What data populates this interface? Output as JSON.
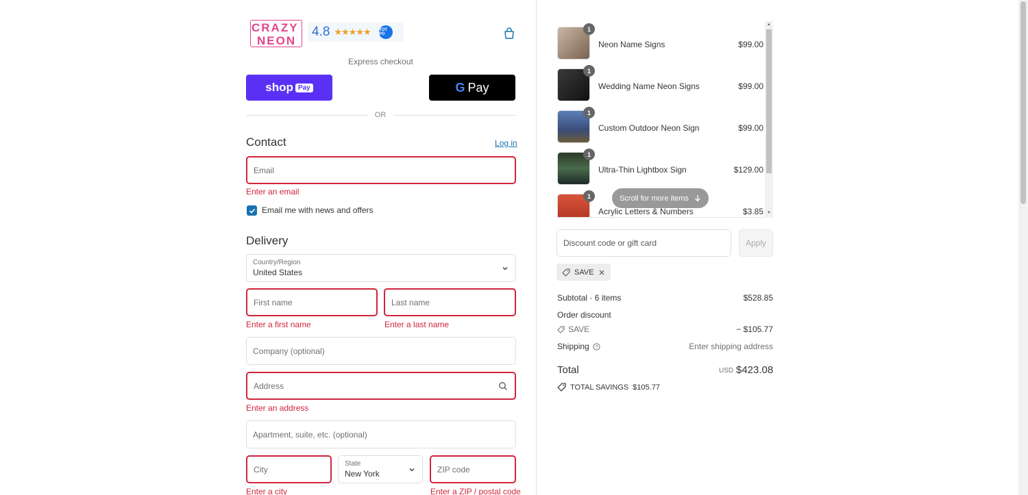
{
  "brand": {
    "logo_line1": "CRAZY",
    "logo_line2": "NEON",
    "rating_value": "4.8",
    "rating_stars": "★★★★★",
    "badge_text": "YOT PO"
  },
  "express": {
    "label": "Express checkout",
    "shop_pay_brand": "shop",
    "shop_pay_pay": "Pay",
    "gpay_g": "G",
    "gpay_pay": "Pay",
    "or": "OR"
  },
  "contact": {
    "title": "Contact",
    "login": "Log in",
    "email_placeholder": "Email",
    "email_error": "Enter an email",
    "newsletter_label": "Email me with news and offers",
    "newsletter_checked": true
  },
  "delivery": {
    "title": "Delivery",
    "country_label": "Country/Region",
    "country_value": "United States",
    "first_name_placeholder": "First name",
    "first_name_error": "Enter a first name",
    "last_name_placeholder": "Last name",
    "last_name_error": "Enter a last name",
    "company_placeholder": "Company (optional)",
    "address_placeholder": "Address",
    "address_error": "Enter an address",
    "apartment_placeholder": "Apartment, suite, etc. (optional)",
    "city_placeholder": "City",
    "city_error": "Enter a city",
    "state_label": "State",
    "state_value": "New York",
    "zip_placeholder": "ZIP code",
    "zip_error": "Enter a ZIP / postal code"
  },
  "cart": {
    "items": [
      {
        "qty": "1",
        "name": "Neon Name Signs",
        "price": "$99.00"
      },
      {
        "qty": "1",
        "name": "Wedding Name Neon Signs",
        "price": "$99.00"
      },
      {
        "qty": "1",
        "name": "Custom Outdoor Neon Sign",
        "price": "$99.00"
      },
      {
        "qty": "1",
        "name": "Ultra-Thin Lightbox Sign",
        "price": "$129.00"
      },
      {
        "qty": "1",
        "name": "Acrylic Letters & Numbers",
        "price": "$3.85"
      }
    ],
    "scroll_hint": "Scroll for more items",
    "discount_placeholder": "Discount code or gift card",
    "apply": "Apply",
    "applied_code": "SAVE"
  },
  "summary": {
    "subtotal_label": "Subtotal · 6 items",
    "subtotal_value": "$528.85",
    "order_discount_label": "Order discount",
    "discount_code": "SAVE",
    "discount_value": "− $105.77",
    "shipping_label": "Shipping",
    "shipping_value": "Enter shipping address",
    "total_label": "Total",
    "total_currency": "USD",
    "total_value": "$423.08",
    "savings_label": "TOTAL SAVINGS",
    "savings_value": "$105.77"
  },
  "colors": {
    "error": "#d0243a",
    "link": "#1773b0",
    "shop_pay": "#5a31f4",
    "brand_pink": "#e2448a"
  }
}
